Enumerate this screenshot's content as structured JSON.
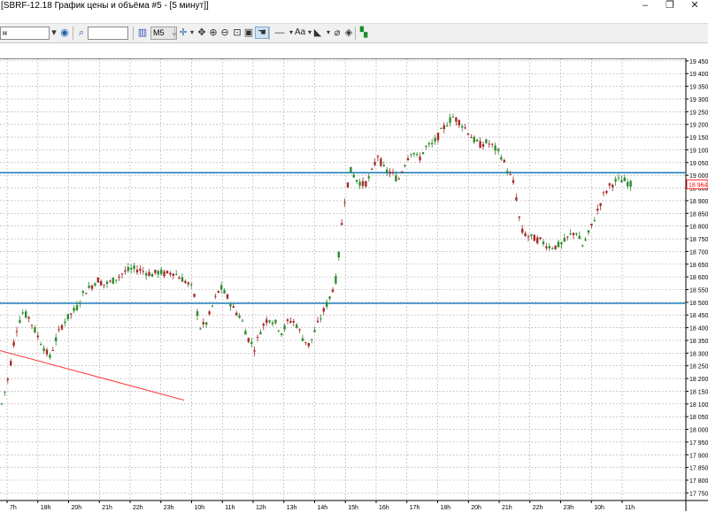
{
  "window": {
    "title": "[SBRF-12.18 График цены и объёма #5 - [5 минут]]",
    "buttons": [
      "–",
      "❐",
      "✕"
    ]
  },
  "toolbar": {
    "symbol_value": "н",
    "search_value": "",
    "timeframe": "M5",
    "text_tool_label": "Aa"
  },
  "icons": {
    "symbol_dropdown": "chevron-down-icon",
    "link": "link-icon",
    "search": "search-icon",
    "bar_chart": "bar-chart-icon",
    "crosshair": "crosshair-icon",
    "move": "move-icon",
    "zoom_in": "zoom-in-icon",
    "zoom_out": "zoom-out-icon",
    "zoom_area": "zoom-area-icon",
    "hand": "hand-icon",
    "line_tool": "line-icon",
    "text_tool": "text-icon",
    "fill": "fill-icon",
    "eraser": "eraser-icon",
    "layers": "layers-icon",
    "indicator": "indicator-icon"
  },
  "colors": {
    "up_candle": "#2e8b2e",
    "down_candle": "#a52a2a",
    "level_line": "#1f7fbf",
    "trend_line": "#ff3b3b",
    "price_marker": "#ff0000",
    "grid": "#aaaaaa"
  },
  "chart_data": {
    "type": "candlestick",
    "symbol": "SBRF-12.18",
    "timeframe": "5 минут",
    "y_ticks": [
      "19 450",
      "19 400",
      "19 350",
      "19 300",
      "19 250",
      "19 200",
      "19 150",
      "19 100",
      "19 050",
      "19 000",
      "18 950",
      "18 900",
      "18 850",
      "18 800",
      "18 750",
      "18 700",
      "18 650",
      "18 600",
      "18 550",
      "18 500",
      "18 450",
      "18 400",
      "18 350",
      "18 300",
      "18 250",
      "18 200",
      "18 150",
      "18 100",
      "18 050",
      "18 000",
      "17 950",
      "17 900",
      "17 850",
      "17 800",
      "17 750"
    ],
    "ylim": [
      17720,
      19460
    ],
    "x_labels": [
      "7h",
      "18h",
      "20h",
      "21h",
      "22h",
      "23h",
      "10h",
      "11h",
      "12h",
      "13h",
      "14h",
      "15h",
      "16h",
      "17h",
      "18h",
      "20h",
      "21h",
      "22h",
      "23h",
      "10h",
      "11h"
    ],
    "last_price": "18 964",
    "horizontal_levels": [
      19010,
      18496
    ],
    "trend_line": {
      "from": [
        0,
        18310
      ],
      "to": [
        208,
        18115
      ]
    },
    "price_path": [
      18100,
      18210,
      18380,
      18460,
      18440,
      18380,
      18330,
      18280,
      18360,
      18420,
      18450,
      18480,
      18540,
      18560,
      18590,
      18570,
      18580,
      18600,
      18620,
      18630,
      18630,
      18620,
      18610,
      18620,
      18610,
      18620,
      18600,
      18580,
      18550,
      18400,
      18420,
      18500,
      18560,
      18520,
      18470,
      18440,
      18360,
      18320,
      18400,
      18440,
      18420,
      18380,
      18430,
      18420,
      18360,
      18330,
      18400,
      18460,
      18520,
      18600,
      18880,
      19020,
      18980,
      18960,
      19000,
      19080,
      19020,
      19010,
      18980,
      19050,
      19100,
      19060,
      19110,
      19120,
      19160,
      19200,
      19230,
      19210,
      19180,
      19140,
      19120,
      19130,
      19110,
      19080,
      19020,
      18960,
      18780,
      18760,
      18750,
      18740,
      18720,
      18720,
      18730,
      18760,
      18780,
      18720,
      18780,
      18850,
      18920,
      18960,
      18980,
      18980,
      18964
    ]
  }
}
